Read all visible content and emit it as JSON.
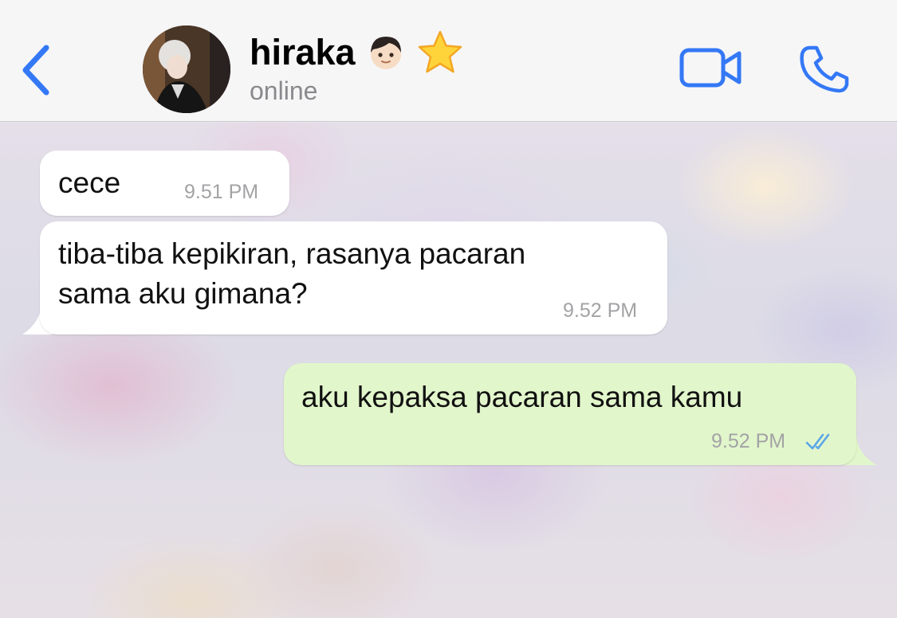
{
  "header": {
    "contact_name": "hiraka",
    "status": "online",
    "name_emojis": [
      "boy-emoji",
      "star-emoji"
    ]
  },
  "icons": {
    "back": "chevron-left-icon",
    "video": "video-camera-icon",
    "call": "phone-icon",
    "read_receipt": "double-check-icon"
  },
  "colors": {
    "accent": "#3478f6",
    "incoming_bubble": "#ffffff",
    "outgoing_bubble": "#e2f6cb",
    "read_tick": "#5aa6e8",
    "timestamp": "#a3a3a6"
  },
  "messages": [
    {
      "direction": "incoming",
      "lines": [
        "cece"
      ],
      "time": "9.51 PM"
    },
    {
      "direction": "incoming",
      "lines": [
        "tiba-tiba kepikiran, rasanya pacaran",
        "sama aku gimana?"
      ],
      "time": "9.52 PM"
    },
    {
      "direction": "outgoing",
      "lines": [
        "aku kepaksa pacaran sama kamu"
      ],
      "time": "9.52 PM",
      "read": true
    }
  ]
}
